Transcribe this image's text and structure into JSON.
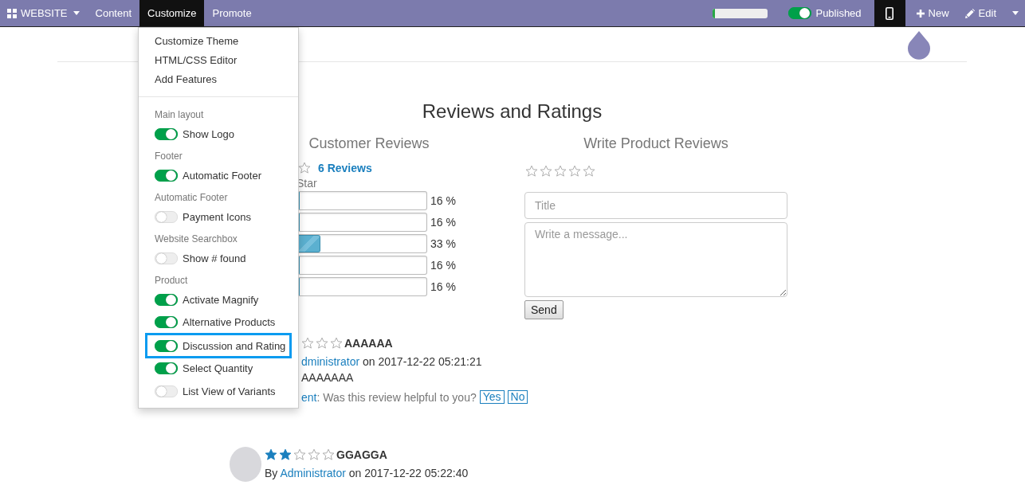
{
  "navbar": {
    "app_menu": "WEBSITE",
    "menus": [
      {
        "label": "Content",
        "selected": false
      },
      {
        "label": "Customize",
        "selected": true
      },
      {
        "label": "Promote",
        "selected": false
      }
    ],
    "progress": {
      "level": 0.04
    },
    "published": {
      "label": "Published",
      "on": true
    },
    "mobile_preview": {
      "selected": true
    },
    "new_button": "New",
    "edit_button": "Edit"
  },
  "customize_menu": {
    "links": [
      "Customize Theme",
      "HTML/CSS Editor",
      "Add Features"
    ],
    "sections": [
      {
        "heading": "Main layout",
        "options": [
          {
            "label": "Show Logo",
            "on": true,
            "highlighted": false
          }
        ]
      },
      {
        "heading": "Footer",
        "options": [
          {
            "label": "Automatic Footer",
            "on": true,
            "highlighted": false
          }
        ]
      },
      {
        "heading": "Automatic Footer",
        "options": [
          {
            "label": "Payment Icons",
            "on": false,
            "highlighted": false
          }
        ]
      },
      {
        "heading": "Website Searchbox",
        "options": [
          {
            "label": "Show # found",
            "on": false,
            "highlighted": false
          }
        ]
      },
      {
        "heading": "Product",
        "options": [
          {
            "label": "Activate Magnify",
            "on": true,
            "highlighted": false
          },
          {
            "label": "Alternative Products",
            "on": true,
            "highlighted": false
          },
          {
            "label": "Discussion and Rating",
            "on": true,
            "highlighted": true
          },
          {
            "label": "Select Quantity",
            "on": true,
            "highlighted": false
          },
          {
            "label": "List View of Variants",
            "on": false,
            "highlighted": false
          }
        ]
      }
    ]
  },
  "page": {
    "title": "Reviews and Ratings",
    "customer_reviews": {
      "heading": "Customer Reviews",
      "review_count": "6 Reviews",
      "rating_label": "Star",
      "bars": [
        {
          "level": 0,
          "percent": "16 %"
        },
        {
          "level": 0,
          "percent": "16 %"
        },
        {
          "level": 0.17,
          "percent": "33 %"
        },
        {
          "level": 0,
          "percent": "16 %"
        },
        {
          "level": 0,
          "percent": "16 %"
        }
      ]
    },
    "write_review": {
      "heading": "Write Product Reviews",
      "stars": 0,
      "title_placeholder": "Title",
      "message_placeholder": "Write a message...",
      "send": "Send"
    },
    "reviews": [
      {
        "kind": "covered",
        "stars": 0,
        "title": "AAAAAA",
        "author": "dministrator",
        "date_text": " on 2017-12-22 05:21:21",
        "body": "AAAAAAA",
        "link": "ent",
        "question": " : Was this review helpful to you?",
        "yes": "Yes",
        "no": "No"
      },
      {
        "kind": "full",
        "stars": 2,
        "title": "GGAGGA",
        "by": "By ",
        "author": "Administrator",
        "date_text": " on 2017-12-22 05:22:40"
      }
    ]
  }
}
